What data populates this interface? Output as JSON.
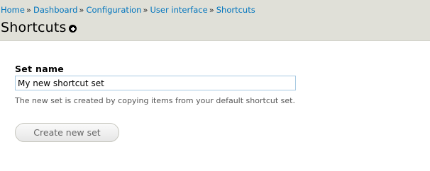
{
  "breadcrumb": {
    "items": [
      "Home",
      "Dashboard",
      "Configuration",
      "User interface",
      "Shortcuts"
    ],
    "separator": "»"
  },
  "page": {
    "title": "Shortcuts",
    "add_icon": "add-circle-icon"
  },
  "form": {
    "set_name_label": "Set name",
    "set_name_value": "My new shortcut set",
    "set_name_description": "The new set is created by copying items from your default shortcut set.",
    "submit_label": "Create new set"
  },
  "colors": {
    "header_bg": "#e0e0d8",
    "link": "#0074bd",
    "input_border": "#a6c9e2"
  }
}
